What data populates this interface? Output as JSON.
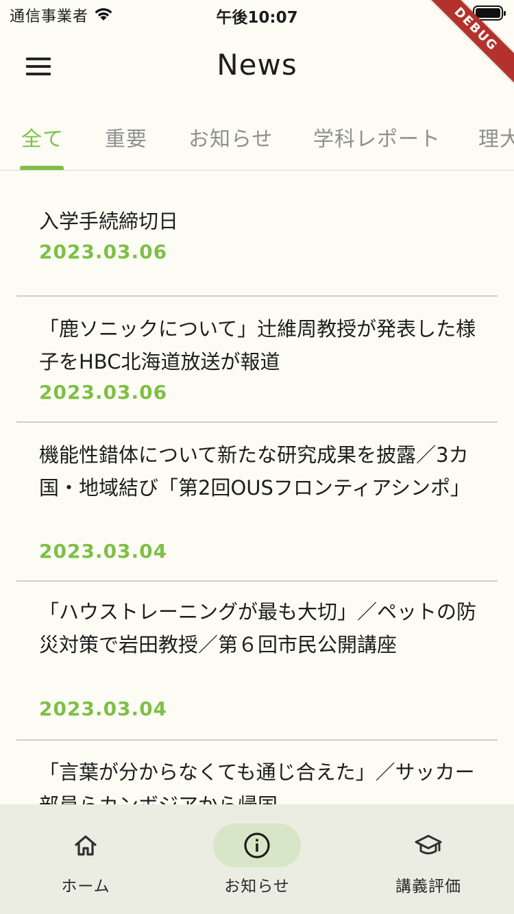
{
  "status_bar": {
    "carrier": "通信事業者",
    "time": "午後10:07"
  },
  "debug_banner": "DEBUG",
  "app_bar": {
    "title": "News"
  },
  "tabs": [
    {
      "label": "全て",
      "active": true
    },
    {
      "label": "重要",
      "active": false
    },
    {
      "label": "お知らせ",
      "active": false
    },
    {
      "label": "学科レポート",
      "active": false
    },
    {
      "label": "理大",
      "active": false
    }
  ],
  "news": [
    {
      "title": "入学手続締切日",
      "date": "2023.03.06"
    },
    {
      "title": "「鹿ソニックについて」辻維周教授が発表した様子をHBC北海道放送が報道",
      "date": "2023.03.06"
    },
    {
      "title": "機能性錯体について新たな研究成果を披露／3カ国・地域結び「第2回OUSフロンティアシンポ」",
      "date": "2023.03.04"
    },
    {
      "title": "「ハウストレーニングが最も大切」／ペットの防災対策で岩田教授／第６回市民公開講座",
      "date": "2023.03.04"
    },
    {
      "title": "「言葉が分からなくても通じ合えた」／サッカー部員らカンボジアから帰国",
      "date": ""
    }
  ],
  "bottom_nav": [
    {
      "label": "ホーム",
      "icon": "home-icon",
      "active": false
    },
    {
      "label": "お知らせ",
      "icon": "info-icon",
      "active": true
    },
    {
      "label": "講義評価",
      "icon": "school-icon",
      "active": false
    }
  ],
  "colors": {
    "accent": "#7ebf45",
    "background": "#fcfcf5",
    "nav_background": "#ebede2",
    "nav_active_pill": "#d8e6c8",
    "debug_ribbon": "#b3322c"
  }
}
